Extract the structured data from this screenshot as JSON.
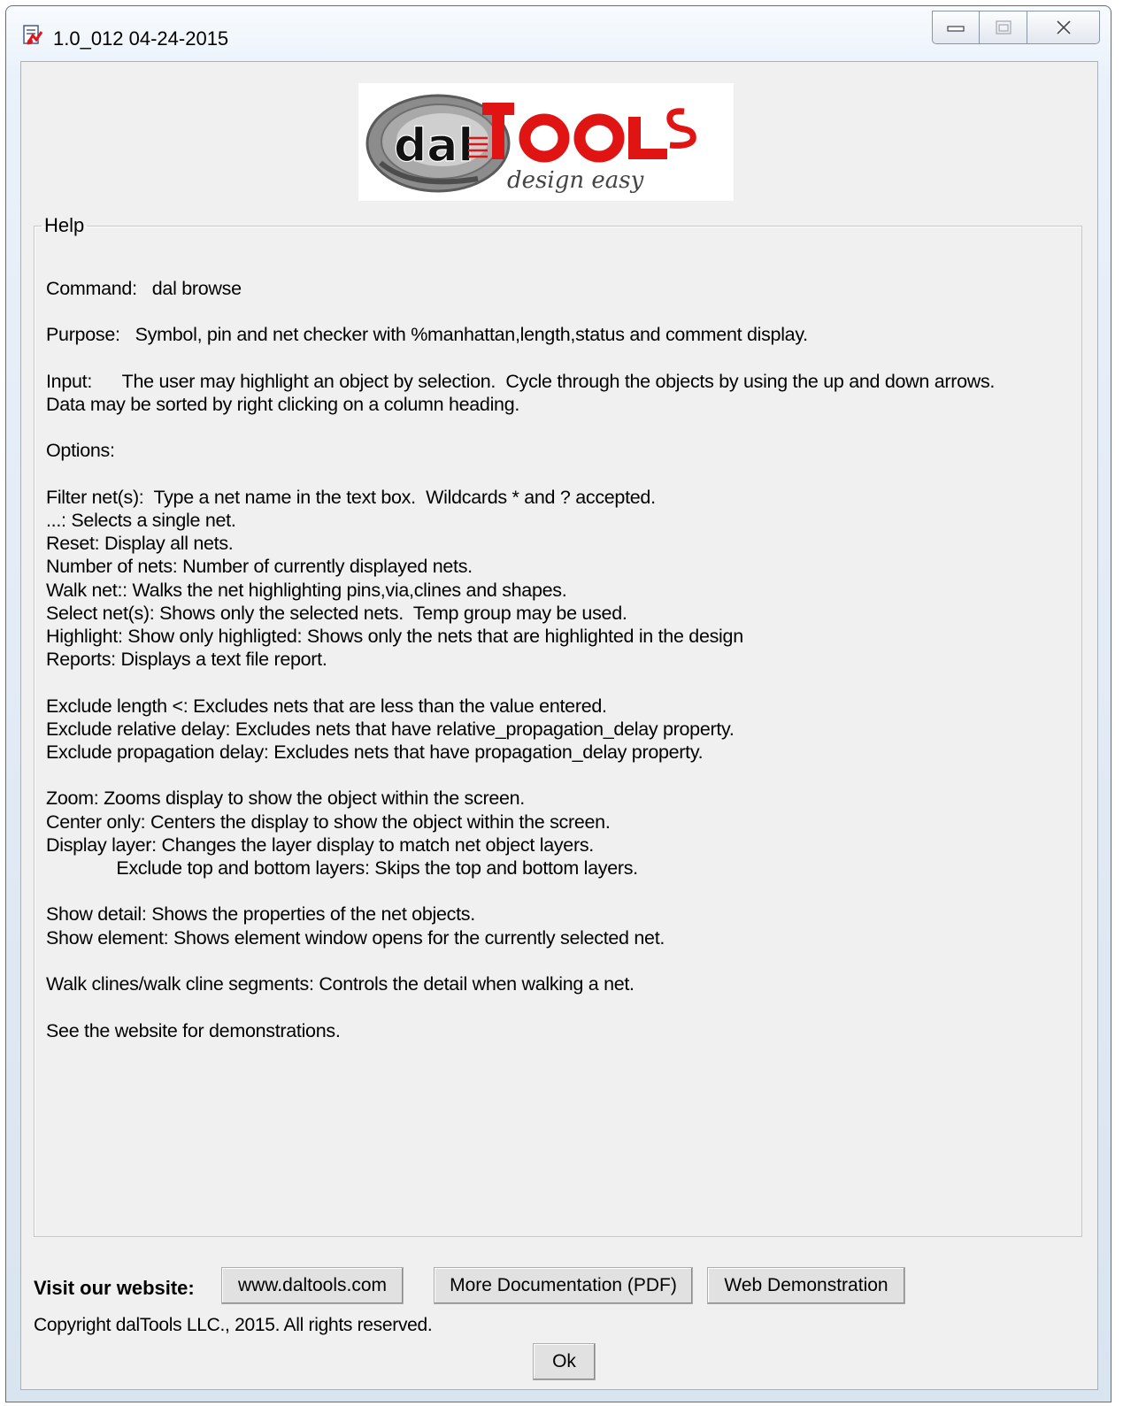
{
  "window": {
    "title": "1.0_012 04-24-2015"
  },
  "logo": {
    "brand_text_left": "dal",
    "brand_text_right": "TooLs",
    "tagline": "design easy"
  },
  "help": {
    "legend": "Help",
    "text": "Command:   dal browse\n\nPurpose:   Symbol, pin and net checker with %manhattan,length,status and comment display.\n\nInput:      The user may highlight an object by selection.  Cycle through the objects by using the up and down arrows.\nData may be sorted by right clicking on a column heading.\n\nOptions:\n\nFilter net(s):  Type a net name in the text box.  Wildcards * and ? accepted.\n...: Selects a single net.\nReset: Display all nets.\nNumber of nets: Number of currently displayed nets.\nWalk net:: Walks the net highlighting pins,via,clines and shapes.\nSelect net(s): Shows only the selected nets.  Temp group may be used.\nHighlight: Show only highligted: Shows only the nets that are highlighted in the design\nReports: Displays a text file report.\n\nExclude length <: Excludes nets that are less than the value entered.\nExclude relative delay: Excludes nets that have relative_propagation_delay property.\nExclude propagation delay: Excludes nets that have propagation_delay property.\n\nZoom: Zooms display to show the object within the screen.\nCenter only: Centers the display to show the object within the screen.\nDisplay layer: Changes the layer display to match net object layers.\n              Exclude top and bottom layers: Skips the top and bottom layers.\n\nShow detail: Shows the properties of the net objects.\nShow element: Shows element window opens for the currently selected net.\n\nWalk clines/walk cline segments: Controls the detail when walking a net.\n\nSee the website for demonstrations."
  },
  "footer": {
    "visit_label": "Visit our website:",
    "website_button": "www.daltools.com",
    "docs_button": "More Documentation (PDF)",
    "demo_button": "Web Demonstration",
    "copyright": "Copyright dalTools LLC., 2015. All rights reserved.",
    "ok_button": "Ok"
  }
}
